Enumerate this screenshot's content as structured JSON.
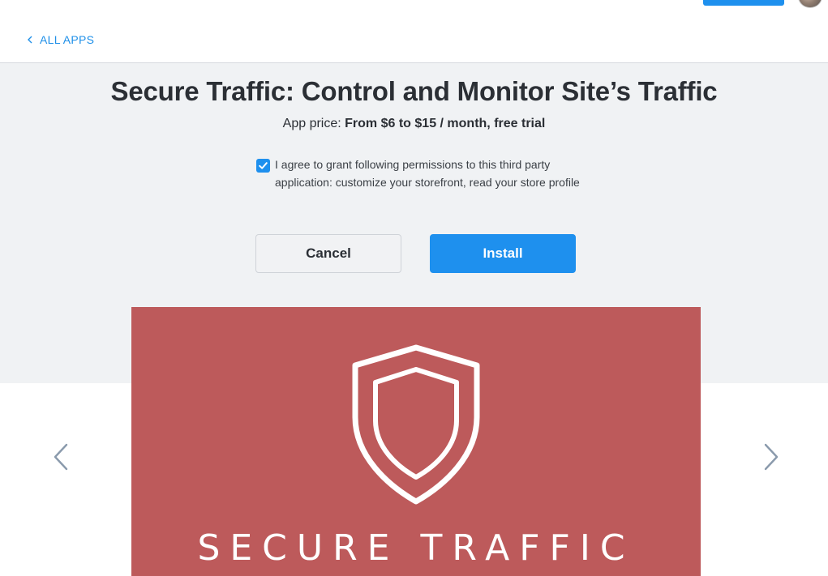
{
  "nav": {
    "back_label": "ALL APPS"
  },
  "app": {
    "title": "Secure Traffic: Control and Monitor Site’s Traffic",
    "price_label": "App price:",
    "price_value": "From $6 to $15 / month, free trial"
  },
  "consent": {
    "checked": true,
    "text": "I agree to grant following permissions to this third party application: customize your storefront, read your store profile"
  },
  "actions": {
    "cancel_label": "Cancel",
    "install_label": "Install"
  },
  "gallery": {
    "banner_text": "SECURE TRAFFIC",
    "banner_color": "#bd5a5b"
  },
  "colors": {
    "accent": "#1e90ee",
    "hero_background": "#f0f2f4"
  }
}
